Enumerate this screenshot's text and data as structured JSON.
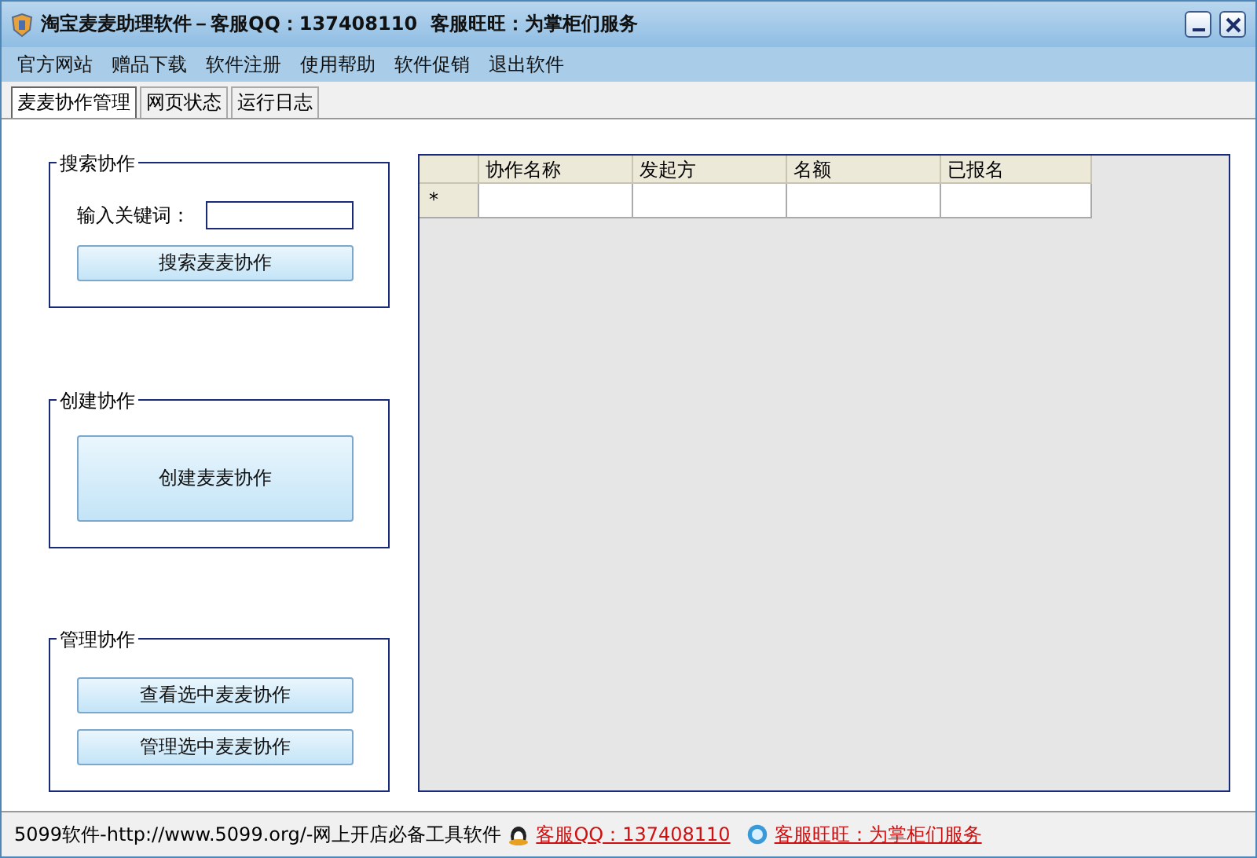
{
  "window": {
    "title": "淘宝麦麦助理软件－客服QQ：137408110  客服旺旺：为掌柜们服务"
  },
  "menu": [
    "官方网站",
    "赠品下载",
    "软件注册",
    "使用帮助",
    "软件促销",
    "退出软件"
  ],
  "tabs": [
    {
      "label": "麦麦协作管理",
      "selected": true
    },
    {
      "label": "网页状态",
      "selected": false
    },
    {
      "label": "运行日志",
      "selected": false
    }
  ],
  "groups": [
    {
      "title": "搜索协作",
      "field": {
        "label": "输入关键词："
      },
      "buttons": [
        "搜索麦麦协作"
      ]
    },
    {
      "title": "创建协作",
      "big_button": "创建麦麦协作"
    },
    {
      "title": "管理协作",
      "buttons": [
        "查看选中麦麦协作",
        "管理选中麦麦协作"
      ]
    }
  ],
  "table": {
    "columns": [
      "协作名称",
      "发起方",
      "名额",
      "已报名"
    ],
    "new_row_marker": "*"
  },
  "status_bar": {
    "text": "5099软件-http://www.5099.org/-网上开店必备工具软件",
    "links": [
      {
        "kind": "qq",
        "text": "客服QQ：137408110"
      },
      {
        "kind": "wangwang",
        "text": "客服旺旺：为掌柜们服务"
      }
    ]
  }
}
